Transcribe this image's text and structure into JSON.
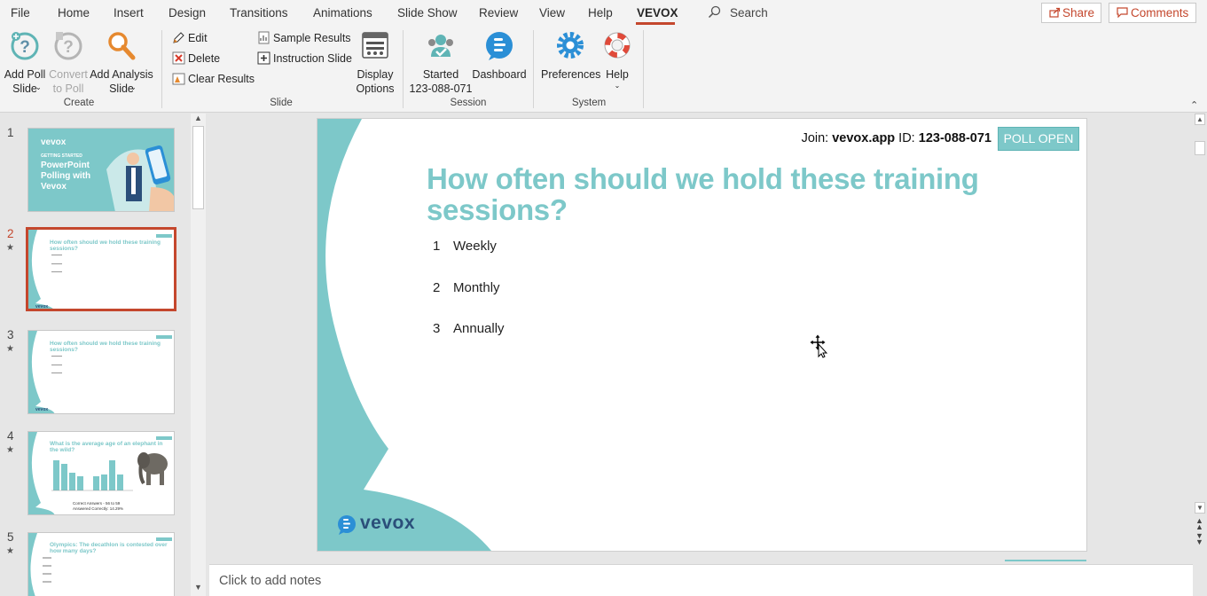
{
  "menubar": {
    "tabs": [
      "File",
      "Home",
      "Insert",
      "Design",
      "Transitions",
      "Animations",
      "Slide Show",
      "Review",
      "View",
      "Help",
      "VEVOX"
    ],
    "active_tab": "VEVOX",
    "search_label": "Search",
    "share_label": "Share",
    "comments_label": "Comments"
  },
  "ribbon": {
    "create": {
      "add_poll_label": "Add Poll\nSlide",
      "convert_label": "Convert\nto Poll",
      "add_analysis_label": "Add Analysis\nSlide",
      "group_label": "Create"
    },
    "slide": {
      "edit_label": "Edit",
      "delete_label": "Delete",
      "clear_label": "Clear Results",
      "sample_label": "Sample Results",
      "instruction_label": "Instruction Slide",
      "display_label": "Display\nOptions",
      "group_label": "Slide"
    },
    "session": {
      "started_label": "Started\n123-088-071",
      "dashboard_label": "Dashboard",
      "group_label": "Session"
    },
    "system": {
      "preferences_label": "Preferences",
      "help_label": "Help",
      "group_label": "System"
    }
  },
  "thumbnails": [
    {
      "num": "1",
      "title": "PowerPoint Polling with Vevox",
      "subtitle": "GETTING STARTED",
      "brand": "vevox"
    },
    {
      "num": "2",
      "title": "How often should we hold these training sessions?",
      "starred": true,
      "selected": true
    },
    {
      "num": "3",
      "title": "How often should we hold these training sessions?",
      "starred": true
    },
    {
      "num": "4",
      "title": "What is the average age of an elephant in the wild?",
      "starred": true,
      "footer1": "Correct Answers - 56 to 59",
      "footer2": "Answered Correctly: 14.29%"
    },
    {
      "num": "5",
      "title": "Olympics: The decathlon is contested over how many days?",
      "starred": true
    }
  ],
  "slide": {
    "join_prefix": "Join: ",
    "join_site": "vevox.app",
    "join_id_prefix": " ID: ",
    "join_id": "123-088-071",
    "poll_status": "POLL OPEN",
    "question": "How often should we hold these training sessions?",
    "options": [
      {
        "num": "1",
        "label": "Weekly"
      },
      {
        "num": "2",
        "label": "Monthly"
      },
      {
        "num": "3",
        "label": "Annually"
      }
    ],
    "brand": "vevox",
    "accent_color": "#7dc8c9"
  },
  "notes": {
    "placeholder": "Click to add notes"
  },
  "colors": {
    "accent_red": "#c4472d",
    "teal": "#7dc8c9",
    "ribbon_bg": "#f3f3f3",
    "workspace_bg": "#e6e6e6"
  }
}
